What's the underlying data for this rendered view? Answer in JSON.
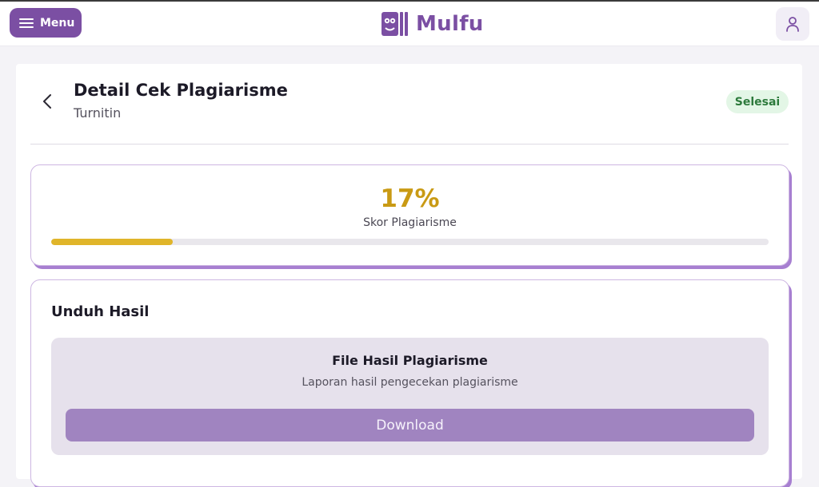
{
  "header": {
    "menu_label": "Menu",
    "brand_name": "Mulfu",
    "brand_color": "#7b4fa3",
    "icons": [
      "menu-icon",
      "brand-logo-icon",
      "user-icon"
    ]
  },
  "page": {
    "title": "Detail Cek Plagiarisme",
    "subtitle": "Turnitin",
    "status": "Selesai",
    "back_icon": "chevron-left-icon"
  },
  "score": {
    "value": "17%",
    "fraction": 0.17,
    "label": "Skor Plagiarisme",
    "color": "#c99a14"
  },
  "download": {
    "section_title": "Unduh Hasil",
    "file_title": "File Hasil Plagiarisme",
    "file_description": "Laporan hasil pengecekan plagiarisme",
    "button_label": "Download"
  }
}
